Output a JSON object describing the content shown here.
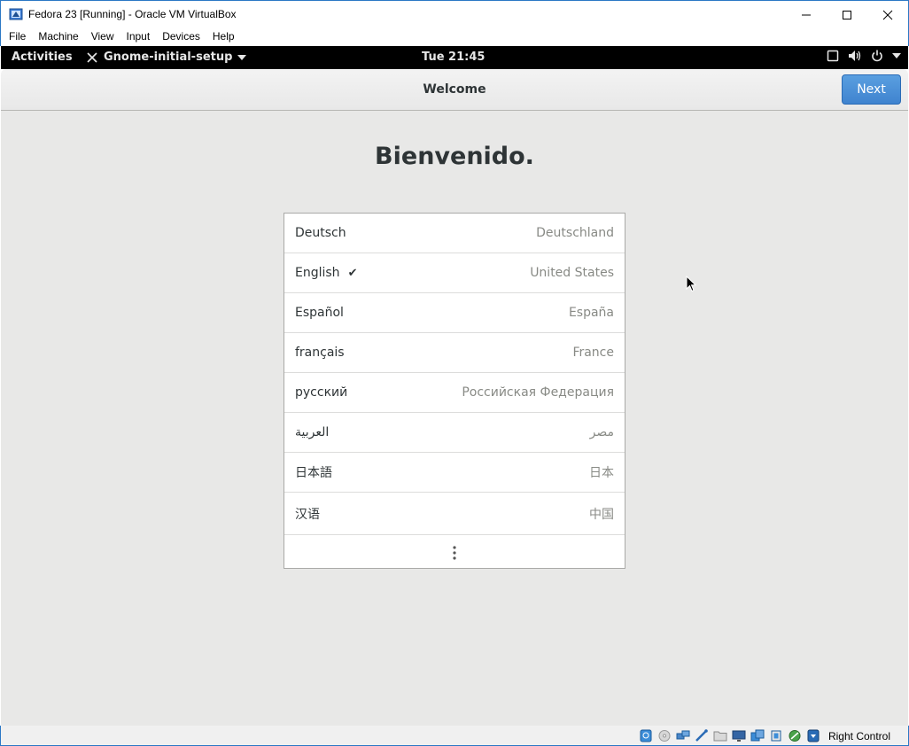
{
  "host": {
    "window_title": "Fedora 23 [Running] - Oracle VM VirtualBox",
    "menu": [
      "File",
      "Machine",
      "View",
      "Input",
      "Devices",
      "Help"
    ],
    "host_key": "Right Control"
  },
  "gnome": {
    "activities": "Activities",
    "app_menu": "Gnome-initial-setup",
    "clock": "Tue 21:45"
  },
  "setup": {
    "header_title": "Welcome",
    "next_label": "Next",
    "welcome_text": "Bienvenido.",
    "languages": [
      {
        "language": "Deutsch",
        "country": "Deutschland",
        "selected": false
      },
      {
        "language": "English",
        "country": "United States",
        "selected": true,
        "check": "✔"
      },
      {
        "language": "Español",
        "country": "España",
        "selected": false
      },
      {
        "language": "français",
        "country": "France",
        "selected": false
      },
      {
        "language": "русский",
        "country": "Российская Федерация",
        "selected": false
      },
      {
        "language": "العربية",
        "country": "مصر",
        "selected": false
      },
      {
        "language": "日本語",
        "country": "日本",
        "selected": false
      },
      {
        "language": "汉语",
        "country": "中国",
        "selected": false
      }
    ],
    "more_icon": "view-more-icon"
  },
  "colors": {
    "accent": "#4a90d9",
    "topbar": "#000000",
    "content_bg": "#e8e8e7"
  }
}
